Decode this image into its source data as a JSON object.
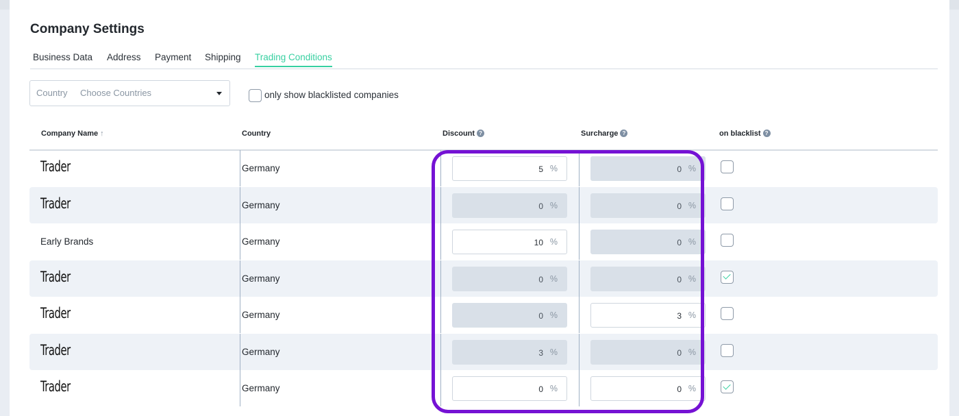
{
  "page_title": "Company Settings",
  "tabs": [
    {
      "label": "Business Data",
      "active": false
    },
    {
      "label": "Address",
      "active": false
    },
    {
      "label": "Payment",
      "active": false
    },
    {
      "label": "Shipping",
      "active": false
    },
    {
      "label": "Trading Conditions",
      "active": true
    }
  ],
  "filters": {
    "country_label": "Country",
    "country_placeholder": "Choose Countries",
    "blacklist_only_label": "only show blacklisted companies",
    "blacklist_only_checked": false
  },
  "columns": {
    "company_name": "Company Name",
    "company_name_sort": "↑",
    "country": "Country",
    "discount": "Discount",
    "surcharge": "Surcharge",
    "on_blacklist": "on blacklist"
  },
  "help_glyph": "?",
  "percent_unit": "%",
  "rows": [
    {
      "name": "Trader",
      "handwritten": true,
      "country": "Germany",
      "discount": "5",
      "discount_disabled": false,
      "surcharge": "0",
      "surcharge_disabled": true,
      "on_blacklist": false
    },
    {
      "name": "Trader",
      "handwritten": true,
      "country": "Germany",
      "discount": "0",
      "discount_disabled": true,
      "surcharge": "0",
      "surcharge_disabled": true,
      "on_blacklist": false
    },
    {
      "name": "Early Brands",
      "handwritten": false,
      "country": "Germany",
      "discount": "10",
      "discount_disabled": false,
      "surcharge": "0",
      "surcharge_disabled": true,
      "on_blacklist": false
    },
    {
      "name": "Trader",
      "handwritten": true,
      "country": "Germany",
      "discount": "0",
      "discount_disabled": true,
      "surcharge": "0",
      "surcharge_disabled": true,
      "on_blacklist": true
    },
    {
      "name": "Trader",
      "handwritten": true,
      "country": "Germany",
      "discount": "0",
      "discount_disabled": true,
      "surcharge": "3",
      "surcharge_disabled": false,
      "on_blacklist": false
    },
    {
      "name": "Trader",
      "handwritten": true,
      "country": "Germany",
      "discount": "3",
      "discount_disabled": true,
      "surcharge": "0",
      "surcharge_disabled": true,
      "on_blacklist": false
    },
    {
      "name": "Trader",
      "handwritten": true,
      "country": "Germany",
      "discount": "0",
      "discount_disabled": false,
      "surcharge": "0",
      "surcharge_disabled": false,
      "on_blacklist": true
    }
  ],
  "colors": {
    "accent": "#37d0a1",
    "highlight": "#7512d4",
    "row_alt": "#eef2f7",
    "disabled_input": "#d9e0e8"
  }
}
